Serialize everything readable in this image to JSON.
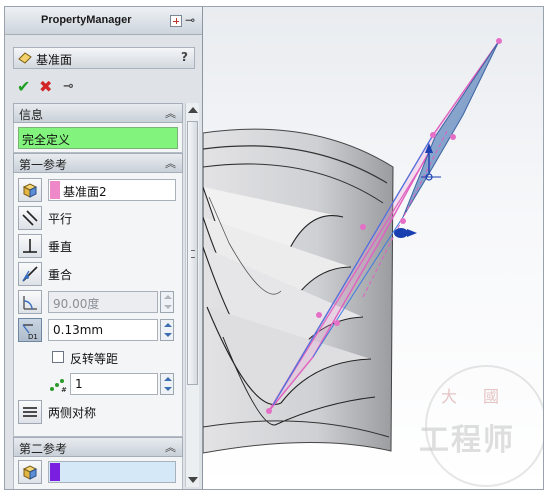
{
  "panel": {
    "title": "PropertyManager",
    "feature_name": "基准面",
    "help": "?",
    "actions": {
      "ok": "✔",
      "cancel": "✖",
      "pin": "⊸"
    }
  },
  "info_group": {
    "title": "信息",
    "status": "完全定义",
    "status_color": "#82f37c"
  },
  "first_ref": {
    "title": "第一参考",
    "selection": "基准面2",
    "selection_color": "#ee88c8",
    "parallel_label": "平行",
    "perpendicular_label": "垂直",
    "coincident_label": "重合",
    "angle_value": "90.00度",
    "distance_value": "0.13mm",
    "flip_label": "反转等距",
    "count_value": "1",
    "midplane_label": "两侧对称"
  },
  "second_ref": {
    "title": "第二参考",
    "selection_color": "#7a1fe0"
  },
  "watermark": {
    "top": "大國",
    "main": "工程师"
  }
}
